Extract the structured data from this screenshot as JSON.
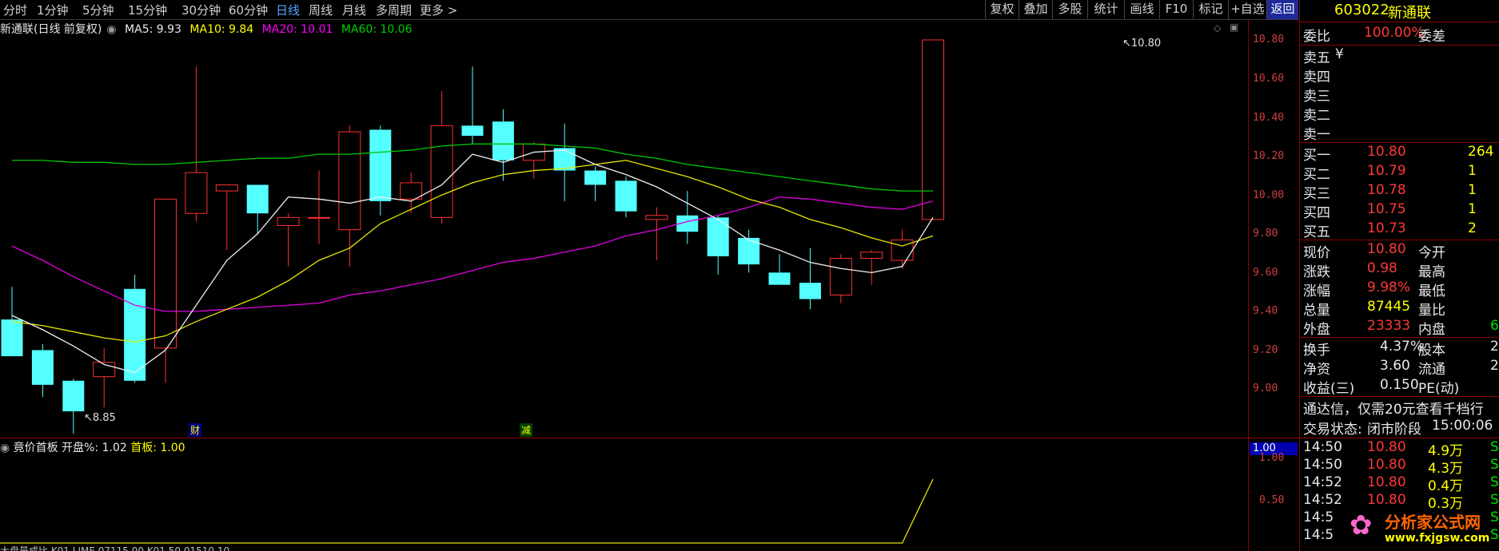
{
  "toolbar": {
    "periods": [
      "分时",
      "1分钟",
      "5分钟",
      "15分钟",
      "30分钟",
      "60分钟",
      "日线",
      "周线",
      "月线",
      "多周期",
      "更多 >"
    ],
    "active_period": "日线",
    "tools": [
      "复权",
      "叠加",
      "多股",
      "统计",
      "画线",
      "F10",
      "标记",
      "+自选",
      "返回"
    ]
  },
  "legend": {
    "title": "新通联(日线 前复权)",
    "ma5": "MA5: 9.93",
    "ma10": "MA10: 9.84",
    "ma20": "MA20: 10.01",
    "ma60": "MA60: 10.06",
    "colors": {
      "ma5": "#ffffff",
      "ma10": "#ffff00",
      "ma20": "#ff00ff",
      "ma60": "#00d000"
    }
  },
  "price_axis": [
    "10.80",
    "10.60",
    "10.40",
    "10.20",
    "10.00",
    "9.80",
    "9.60",
    "9.40",
    "9.20",
    "9.00"
  ],
  "annotations": {
    "high": "10.80",
    "low": "8.85",
    "marker_cai": "财",
    "marker_jian": "减"
  },
  "indicator": {
    "name": "竟价首板",
    "kp_label": "开盘%:",
    "kp_value": "1.02",
    "sb_label": "首板:",
    "sb_value": "1.00",
    "current": "1.00",
    "axis": [
      "1.00",
      "0.50"
    ],
    "values": [
      0,
      0,
      0,
      0,
      0,
      0,
      0,
      0,
      0,
      0,
      0,
      0,
      0,
      0,
      0,
      0,
      0,
      0,
      0,
      0,
      0,
      0,
      0,
      0,
      0,
      0,
      0,
      0,
      0,
      0,
      1.0
    ]
  },
  "bottom_text": "大盘量成比  K01.LIME  07115.00  K01.50  01510.10",
  "chart_data": {
    "type": "candlestick",
    "title": "新通联(日线 前复权)",
    "ylim": [
      8.8,
      10.85
    ],
    "candles": [
      {
        "o": 9.43,
        "h": 9.59,
        "l": 9.33,
        "c": 9.25
      },
      {
        "o": 9.28,
        "h": 9.31,
        "l": 9.05,
        "c": 9.11
      },
      {
        "o": 9.13,
        "h": 9.14,
        "l": 8.87,
        "c": 8.98
      },
      {
        "o": 9.15,
        "h": 9.29,
        "l": 9.0,
        "c": 9.22
      },
      {
        "o": 9.58,
        "h": 9.65,
        "l": 9.12,
        "c": 9.13
      },
      {
        "o": 9.29,
        "h": 10.02,
        "l": 9.12,
        "c": 10.02
      },
      {
        "o": 9.95,
        "h": 10.67,
        "l": 9.91,
        "c": 10.15
      },
      {
        "o": 10.06,
        "h": 10.08,
        "l": 9.77,
        "c": 10.09
      },
      {
        "o": 10.09,
        "h": 10.09,
        "l": 9.85,
        "c": 9.95
      },
      {
        "o": 9.89,
        "h": 9.95,
        "l": 9.69,
        "c": 9.93
      },
      {
        "o": 9.93,
        "h": 10.16,
        "l": 9.8,
        "c": 9.93
      },
      {
        "o": 9.87,
        "h": 10.38,
        "l": 9.69,
        "c": 10.35
      },
      {
        "o": 10.36,
        "h": 10.38,
        "l": 9.94,
        "c": 10.01
      },
      {
        "o": 10.02,
        "h": 10.15,
        "l": 9.95,
        "c": 10.1
      },
      {
        "o": 9.93,
        "h": 10.55,
        "l": 9.9,
        "c": 10.38
      },
      {
        "o": 10.38,
        "h": 10.67,
        "l": 10.29,
        "c": 10.33
      },
      {
        "o": 10.4,
        "h": 10.46,
        "l": 10.11,
        "c": 10.21
      },
      {
        "o": 10.21,
        "h": 10.3,
        "l": 10.12,
        "c": 10.29
      },
      {
        "o": 10.27,
        "h": 10.39,
        "l": 10.01,
        "c": 10.16
      },
      {
        "o": 10.16,
        "h": 10.18,
        "l": 10.01,
        "c": 10.09
      },
      {
        "o": 10.11,
        "h": 10.13,
        "l": 9.93,
        "c": 9.96
      },
      {
        "o": 9.92,
        "h": 9.98,
        "l": 9.72,
        "c": 9.94
      },
      {
        "o": 9.94,
        "h": 10.06,
        "l": 9.8,
        "c": 9.86
      },
      {
        "o": 9.93,
        "h": 9.94,
        "l": 9.65,
        "c": 9.74
      },
      {
        "o": 9.83,
        "h": 9.87,
        "l": 9.66,
        "c": 9.7
      },
      {
        "o": 9.66,
        "h": 9.75,
        "l": 9.6,
        "c": 9.6
      },
      {
        "o": 9.61,
        "h": 9.78,
        "l": 9.48,
        "c": 9.53
      },
      {
        "o": 9.55,
        "h": 9.75,
        "l": 9.51,
        "c": 9.73
      },
      {
        "o": 9.73,
        "h": 9.77,
        "l": 9.6,
        "c": 9.76
      },
      {
        "o": 9.72,
        "h": 9.87,
        "l": 9.68,
        "c": 9.82
      },
      {
        "o": 9.92,
        "h": 10.8,
        "l": 9.92,
        "c": 10.8
      }
    ],
    "ma5": [
      9.45,
      9.38,
      9.3,
      9.21,
      9.17,
      9.28,
      9.5,
      9.72,
      9.85,
      10.03,
      10.02,
      10.0,
      10.03,
      10.01,
      10.09,
      10.24,
      10.2,
      10.25,
      10.26,
      10.19,
      10.14,
      10.08,
      10.0,
      9.92,
      9.82,
      9.77,
      9.71,
      9.68,
      9.66,
      9.69,
      9.93
    ],
    "ma10": [
      9.42,
      9.4,
      9.37,
      9.34,
      9.32,
      9.35,
      9.42,
      9.48,
      9.54,
      9.62,
      9.72,
      9.78,
      9.9,
      9.97,
      10.04,
      10.1,
      10.14,
      10.16,
      10.17,
      10.19,
      10.21,
      10.17,
      10.13,
      10.08,
      10.02,
      9.98,
      9.92,
      9.88,
      9.83,
      9.79,
      9.84
    ],
    "ma20": [
      9.79,
      9.72,
      9.64,
      9.57,
      9.5,
      9.47,
      9.47,
      9.48,
      9.49,
      9.5,
      9.51,
      9.55,
      9.57,
      9.6,
      9.63,
      9.67,
      9.71,
      9.73,
      9.76,
      9.79,
      9.84,
      9.87,
      9.91,
      9.94,
      9.98,
      10.03,
      10.02,
      10.0,
      9.98,
      9.97,
      10.01
    ],
    "ma60": [
      10.21,
      10.21,
      10.2,
      10.2,
      10.19,
      10.19,
      10.2,
      10.21,
      10.22,
      10.22,
      10.24,
      10.24,
      10.25,
      10.26,
      10.28,
      10.29,
      10.29,
      10.29,
      10.28,
      10.27,
      10.24,
      10.22,
      10.19,
      10.17,
      10.15,
      10.13,
      10.11,
      10.09,
      10.07,
      10.06,
      10.06
    ]
  },
  "sidebar": {
    "code": "603022",
    "name": "新通联",
    "weibi_label": "委比",
    "weibi_value": "100.00%",
    "weicha_label": "委差",
    "sell": [
      {
        "label": "卖五",
        "price": "¥",
        "vol": ""
      },
      {
        "label": "卖四",
        "price": "",
        "vol": ""
      },
      {
        "label": "卖三",
        "price": "",
        "vol": ""
      },
      {
        "label": "卖二",
        "price": "",
        "vol": ""
      },
      {
        "label": "卖一",
        "price": "",
        "vol": ""
      }
    ],
    "buy": [
      {
        "label": "买一",
        "price": "10.80",
        "vol": "264"
      },
      {
        "label": "买二",
        "price": "10.79",
        "vol": "1"
      },
      {
        "label": "买三",
        "price": "10.78",
        "vol": "1"
      },
      {
        "label": "买四",
        "price": "10.75",
        "vol": "1"
      },
      {
        "label": "买五",
        "price": "10.73",
        "vol": "2"
      }
    ],
    "quote": [
      {
        "l1": "现价",
        "v1": "10.80",
        "l2": "今开",
        "v2": ""
      },
      {
        "l1": "涨跌",
        "v1": "0.98",
        "l2": "最高",
        "v2": ""
      },
      {
        "l1": "涨幅",
        "v1": "9.98%",
        "l2": "最低",
        "v2": ""
      },
      {
        "l1": "总量",
        "v1": "87445",
        "l2": "量比",
        "v2": ""
      },
      {
        "l1": "外盘",
        "v1": "23333",
        "l2": "内盘",
        "v2": "6"
      }
    ],
    "fundamentals": [
      {
        "l1": "换手",
        "v1": "4.37%",
        "l2": "股本",
        "v2": "2."
      },
      {
        "l1": "净资",
        "v1": "3.60",
        "l2": "流通",
        "v2": "2."
      },
      {
        "l1": "收益(三)",
        "v1": "0.150",
        "l2": "PE(动)",
        "v2": ""
      }
    ],
    "promo": "通达信，仅需20元查看千档行",
    "status_label": "交易状态:",
    "status_value": "闭市阶段",
    "status_time": "15:00:06",
    "ticks": [
      {
        "time": "14:50",
        "price": "10.80",
        "vol": "4.9万",
        "side": "S"
      },
      {
        "time": "14:50",
        "price": "10.80",
        "vol": "4.3万",
        "side": "S"
      },
      {
        "time": "14:52",
        "price": "10.80",
        "vol": "0.4万",
        "side": "S"
      },
      {
        "time": "14:52",
        "price": "10.80",
        "vol": "0.3万",
        "side": "S"
      },
      {
        "time": "14:5",
        "price": "",
        "vol": "",
        "side": "S"
      },
      {
        "time": "14:5",
        "price": "",
        "vol": "",
        "side": "S"
      }
    ],
    "watermark": "分析家公式网",
    "watermark_url": "www.fxjgsw.com"
  }
}
